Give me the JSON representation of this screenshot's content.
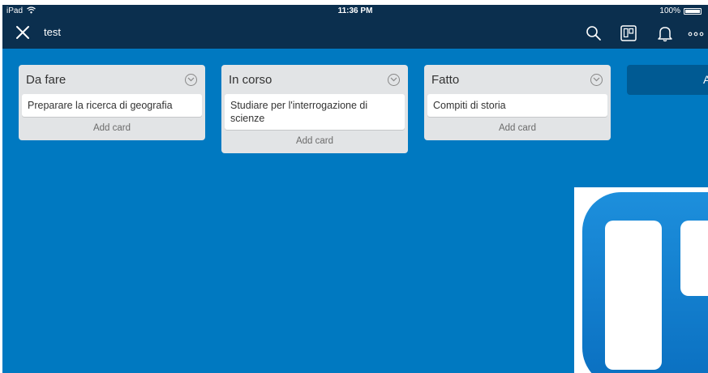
{
  "status_bar": {
    "device": "iPad",
    "time": "11:36 PM",
    "battery": "100%"
  },
  "header": {
    "close_icon": "close-icon",
    "board_title": "test",
    "icons": [
      "search-icon",
      "board-view-icon",
      "bell-icon",
      "more-icon"
    ]
  },
  "lists": [
    {
      "title": "Da fare",
      "cards": [
        "Preparare la ricerca di geografia"
      ],
      "add_card_label": "Add card"
    },
    {
      "title": "In corso",
      "cards": [
        "Studiare per l'interrogazione di scienze"
      ],
      "add_card_label": "Add card"
    },
    {
      "title": "Fatto",
      "cards": [
        "Compiti di storia"
      ],
      "add_card_label": "Add card"
    }
  ],
  "add_list_button": {
    "label": "A"
  },
  "colors": {
    "board_background": "#0079c1",
    "header": "#0b2f4e",
    "list_background": "#e2e4e6"
  }
}
